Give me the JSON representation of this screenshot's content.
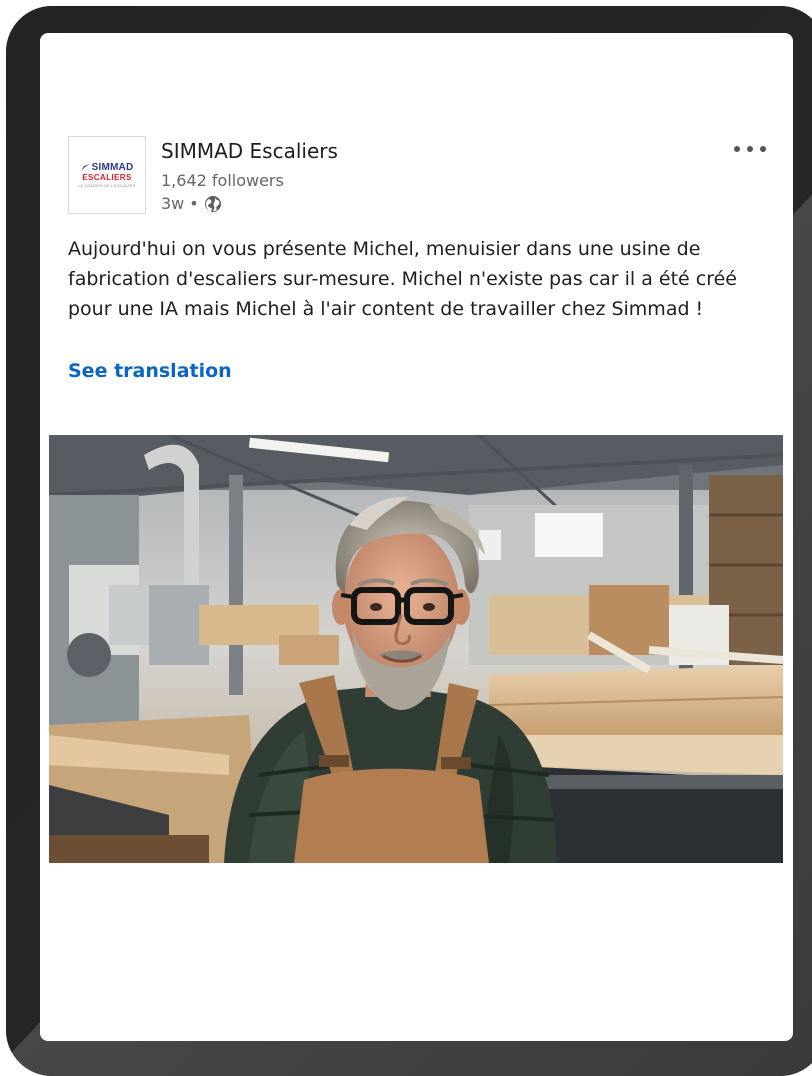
{
  "post": {
    "author": {
      "name": "SIMMAD Escaliers",
      "followers": "1,642 followers",
      "time": "3w",
      "separator": "•",
      "visibility_icon": "globe-icon"
    },
    "logo": {
      "line1": "SIMMAD",
      "line2": "ESCALIERS",
      "tagline": "LE LEADER DE L'ESCALIER"
    },
    "text": "Aujourd'hui on vous présente Michel, menuisier dans une usine de fabrication d'escaliers sur-mesure. Michel n'existe pas car il a été créé pour une IA mais Michel à l'air content de travailler chez Simmad !",
    "see_translation": "See translation",
    "more_icon": "more-options-icon"
  },
  "colors": {
    "link": "#0a66c2",
    "text": "#1f1f1f",
    "muted": "#666666",
    "logo_blue": "#2b3990",
    "logo_red": "#d2232a"
  }
}
